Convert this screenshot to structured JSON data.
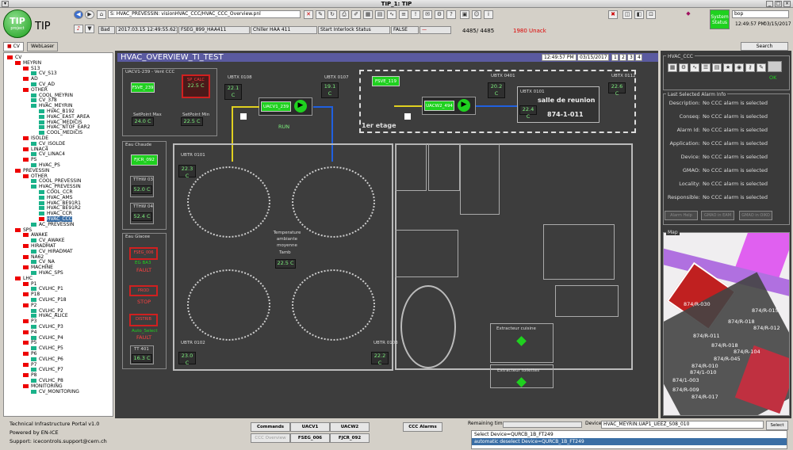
{
  "window": {
    "title": "TIP_1: TIP"
  },
  "app": {
    "logo_text": "TIP",
    "logo_sub": "project",
    "name": "TIP"
  },
  "toolbar": {
    "path": "S: HVAC_PREVESSIN: visionHVAC_CCC/HVAC_CCC_Overview.pnl",
    "user": "Bad",
    "timestamp": "2017.03.15 12:49:55.621",
    "device": "FSEG_899_HAA411",
    "chiller": "Chiller HAA 411",
    "event": "Start Interlock Status",
    "state": "FALSE",
    "counter": "4485/ 4485",
    "unack": "1980 Unack",
    "status_button": "System Status",
    "search_value": "bop",
    "clock_time": "12:49:57 PM",
    "clock_date": "03/15/2017"
  },
  "tabs": [
    {
      "label": "CV"
    },
    {
      "label": "WebLaser"
    }
  ],
  "tree": [
    {
      "label": "CV",
      "d": 0,
      "c": "red"
    },
    {
      "label": "MEYRIN",
      "d": 1,
      "c": "red"
    },
    {
      "label": "S13",
      "d": 2,
      "c": "red"
    },
    {
      "label": "CV_S13",
      "d": 3,
      "c": "teal"
    },
    {
      "label": "AD",
      "d": 2,
      "c": "red"
    },
    {
      "label": "CV_AD",
      "d": 3,
      "c": "teal"
    },
    {
      "label": "OTHER",
      "d": 2,
      "c": "red"
    },
    {
      "label": "COOL_MEYRIN",
      "d": 3,
      "c": "teal"
    },
    {
      "label": "CV_378",
      "d": 3,
      "c": "teal"
    },
    {
      "label": "HVAC_MEYRIN",
      "d": 3,
      "c": "teal"
    },
    {
      "label": "HVAC_B192",
      "d": 4,
      "c": "teal"
    },
    {
      "label": "HVAC_EAST_AREA",
      "d": 4,
      "c": "teal"
    },
    {
      "label": "HVAC_MEDICIS",
      "d": 4,
      "c": "teal"
    },
    {
      "label": "HVAC_NTOF_EAR2",
      "d": 4,
      "c": "teal"
    },
    {
      "label": "COOL_MEDICIS",
      "d": 4,
      "c": "teal"
    },
    {
      "label": "ISOLDE",
      "d": 2,
      "c": "red"
    },
    {
      "label": "CV_ISOLDE",
      "d": 3,
      "c": "teal"
    },
    {
      "label": "LINAC4",
      "d": 2,
      "c": "red"
    },
    {
      "label": "CV_LINAC4",
      "d": 3,
      "c": "teal"
    },
    {
      "label": "PS",
      "d": 2,
      "c": "red"
    },
    {
      "label": "HVAC_PS",
      "d": 3,
      "c": "teal"
    },
    {
      "label": "PREVESSIN",
      "d": 1,
      "c": "red"
    },
    {
      "label": "OTHER",
      "d": 2,
      "c": "red"
    },
    {
      "label": "COOL_PREVESSIN",
      "d": 3,
      "c": "teal"
    },
    {
      "label": "HVAC_PREVESSIN",
      "d": 3,
      "c": "teal"
    },
    {
      "label": "COOL_CCR",
      "d": 4,
      "c": "teal"
    },
    {
      "label": "HVAC_AMS",
      "d": 4,
      "c": "teal"
    },
    {
      "label": "HVAC_BE91R1",
      "d": 4,
      "c": "teal"
    },
    {
      "label": "HVAC_BE91R2",
      "d": 4,
      "c": "teal"
    },
    {
      "label": "HVAC_CCR",
      "d": 4,
      "c": "teal"
    },
    {
      "label": "HVAC_CCC",
      "d": 4,
      "c": "red",
      "sel": true
    },
    {
      "label": "AC_PREVESSIN",
      "d": 3,
      "c": "teal"
    },
    {
      "label": "SPS",
      "d": 1,
      "c": "red"
    },
    {
      "label": "AWAKE",
      "d": 2,
      "c": "red"
    },
    {
      "label": "CV_AWAKE",
      "d": 3,
      "c": "teal"
    },
    {
      "label": "HIRADMAT",
      "d": 2,
      "c": "red"
    },
    {
      "label": "CV_HIRADMAT",
      "d": 3,
      "c": "teal"
    },
    {
      "label": "NA62",
      "d": 2,
      "c": "red"
    },
    {
      "label": "CV_NA",
      "d": 3,
      "c": "teal"
    },
    {
      "label": "MACHINE",
      "d": 2,
      "c": "red"
    },
    {
      "label": "HVAC_SPS",
      "d": 3,
      "c": "teal"
    },
    {
      "label": "LHC",
      "d": 1,
      "c": "red"
    },
    {
      "label": "P1",
      "d": 2,
      "c": "red"
    },
    {
      "label": "CVLHC_P1",
      "d": 3,
      "c": "teal"
    },
    {
      "label": "P18",
      "d": 2,
      "c": "red"
    },
    {
      "label": "CVLHC_P18",
      "d": 3,
      "c": "teal"
    },
    {
      "label": "P2",
      "d": 2,
      "c": "red"
    },
    {
      "label": "CVLHC_P2",
      "d": 3,
      "c": "teal"
    },
    {
      "label": "HVAC_ALICE",
      "d": 3,
      "c": "teal"
    },
    {
      "label": "P3",
      "d": 2,
      "c": "red"
    },
    {
      "label": "CVLHC_P3",
      "d": 3,
      "c": "teal"
    },
    {
      "label": "P4",
      "d": 2,
      "c": "red"
    },
    {
      "label": "CVLHC_P4",
      "d": 3,
      "c": "teal"
    },
    {
      "label": "P5",
      "d": 2,
      "c": "red"
    },
    {
      "label": "CVLHC_P5",
      "d": 3,
      "c": "teal"
    },
    {
      "label": "P6",
      "d": 2,
      "c": "red"
    },
    {
      "label": "CVLHC_P6",
      "d": 3,
      "c": "teal"
    },
    {
      "label": "P7",
      "d": 2,
      "c": "red"
    },
    {
      "label": "CVLHC_P7",
      "d": 3,
      "c": "teal"
    },
    {
      "label": "P8",
      "d": 2,
      "c": "red"
    },
    {
      "label": "CVLHC_P8",
      "d": 3,
      "c": "teal"
    },
    {
      "label": "MONITORING",
      "d": 2,
      "c": "red"
    },
    {
      "label": "CV_MONITORING",
      "d": 3,
      "c": "teal"
    }
  ],
  "synoptic": {
    "title": "HVAC_OVERVIEW_TI_TEST",
    "time": "12:49:57 PM",
    "date": "03/15/2017",
    "pages": [
      "1",
      "2",
      "3",
      "4"
    ],
    "uacv1": {
      "group": "UACV1-239 - Vent CCC",
      "fsve": "FSVE_239",
      "sp_calc_label": "SP_CALC",
      "sp_calc": "22.5 C",
      "unit": "UACV1_239",
      "state": "RUN",
      "sp_max_label": "SetPoint Max",
      "sp_max": "24.0 C",
      "sp_min_label": "SetPoint Min",
      "sp_min": "22.5 C"
    },
    "uacv2": {
      "fsve": "FSVE_119",
      "unit": "UACW2_494",
      "room": "salle de reunion",
      "room_id": "874-1-011",
      "floor": "1er etage"
    },
    "sensors": [
      {
        "id": "UBTX 0108",
        "v": "22.1 C"
      },
      {
        "id": "UBTX 0107",
        "v": "19.1 C"
      },
      {
        "id": "UBTX 0401",
        "v": "20.2 C"
      },
      {
        "id": "UBTX 0101",
        "v": "22.4 C"
      },
      {
        "id": "UBTX 0112",
        "v": "22.6 C"
      },
      {
        "id": "UBTR 0101",
        "v": "22.3 C"
      },
      {
        "id": "UBTR 0102",
        "v": "23.0 C"
      },
      {
        "id": "UBTR 0103",
        "v": "22.2 C"
      }
    ],
    "eau_chaude": {
      "label": "Eau Chaude",
      "fjcr": "FJCR_092",
      "t1_label": "TTHW 03",
      "t1": "52.0 C",
      "t2_label": "TTHW 04",
      "t2": "52.4 C"
    },
    "eau_glacee": {
      "label": "Eau Glacee",
      "b1": "FSEG_006",
      "b1_sub": "EG BA3",
      "b1_state": "FAULT",
      "b2": "PROD",
      "b2_state": "STOP",
      "b3": "DISTRIB",
      "b3_sub": "Auto_Select",
      "b3_state": "FAULT",
      "t_label": "TT 401",
      "t": "16.3 C"
    },
    "tamb": {
      "label": "Temperature ambiante moyenne",
      "id": "Tamb",
      "v": "22.5 C"
    },
    "extract1": "Extracteur cuisine",
    "extract2": "Extracteur toilettes"
  },
  "hvac_ccc": {
    "label": "HVAC_CCC",
    "ok": "OK"
  },
  "alarm": {
    "label": "Last Selected Alarm Info",
    "rows": [
      {
        "k": "Description:",
        "v": "No CCC alarm is selected"
      },
      {
        "k": "Conseq:",
        "v": "No CCC alarm is selected"
      },
      {
        "k": "Alarm Id:",
        "v": "No CCC alarm is selected"
      },
      {
        "k": "Application:",
        "v": "No CCC alarm is selected"
      },
      {
        "k": "Device:",
        "v": "No CCC alarm is selected"
      },
      {
        "k": "GMAO:",
        "v": "No CCC alarm is selected"
      },
      {
        "k": "Locality:",
        "v": "No CCC alarm is selected"
      },
      {
        "k": "Responsible:",
        "v": "No CCC alarm is selected"
      }
    ],
    "buttons": [
      "Alarm Help",
      "GMAO in EAM",
      "GMAO in OIKO"
    ]
  },
  "map": {
    "label": "Map",
    "tags": [
      "874/R-030",
      "874/R-015",
      "874/R-018",
      "874/R-012",
      "874/R-011",
      "874/R-018",
      "874/R-104",
      "874/R-045",
      "874/R-010",
      "874/1-010",
      "874/1-003",
      "874/R-009",
      "874/R-017"
    ]
  },
  "search_btn": "Search",
  "footer": {
    "line1": "Technical Infrastructure Portal v1.0",
    "line2": "Powered by EN-ICE",
    "line3": "Support: icecontrols.support@cern.ch",
    "buttons": [
      "Commands",
      "UACV1",
      "UACW2",
      "CCC Alarms",
      "CCC Overview",
      "FSEG_006",
      "FJCR_092"
    ],
    "remaining": "Remaining time",
    "device_label": "Device",
    "device_value": "HVAC_MEYRIN:UAP1_UEEZ_S08_010",
    "select_btn": "Select",
    "log1": "Select Device=QURCB_1B_FT249",
    "log2": "automatic deselect Device=QURCB_1B_FT249"
  }
}
